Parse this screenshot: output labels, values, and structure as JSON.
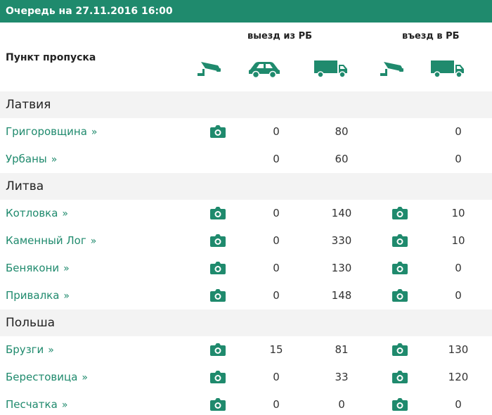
{
  "topbar": {
    "title": "Очередь на 27.11.2016 16:00"
  },
  "header": {
    "checkpoint_label": "Пункт пропуска",
    "exit_title": "выезд из РБ",
    "entry_title": "въезд в РБ"
  },
  "sections": [
    {
      "name": "Латвия",
      "rows": [
        {
          "name": "Григоровщина",
          "cam_out": true,
          "out_car": "0",
          "out_truck": "80",
          "cam_in": false,
          "in_truck": "0"
        },
        {
          "name": "Урбаны",
          "cam_out": false,
          "out_car": "0",
          "out_truck": "60",
          "cam_in": false,
          "in_truck": "0"
        }
      ]
    },
    {
      "name": "Литва",
      "rows": [
        {
          "name": "Котловка",
          "cam_out": true,
          "out_car": "0",
          "out_truck": "140",
          "cam_in": true,
          "in_truck": "10"
        },
        {
          "name": "Каменный Лог",
          "cam_out": true,
          "out_car": "0",
          "out_truck": "330",
          "cam_in": true,
          "in_truck": "10"
        },
        {
          "name": "Бенякони",
          "cam_out": true,
          "out_car": "0",
          "out_truck": "130",
          "cam_in": true,
          "in_truck": "0"
        },
        {
          "name": "Привалка",
          "cam_out": true,
          "out_car": "0",
          "out_truck": "148",
          "cam_in": true,
          "in_truck": "0"
        }
      ]
    },
    {
      "name": "Польша",
      "rows": [
        {
          "name": "Брузги",
          "cam_out": true,
          "out_car": "15",
          "out_truck": "81",
          "cam_in": true,
          "in_truck": "130"
        },
        {
          "name": "Берестовица",
          "cam_out": true,
          "out_car": "0",
          "out_truck": "33",
          "cam_in": true,
          "in_truck": "120"
        },
        {
          "name": "Песчатка",
          "cam_out": true,
          "out_car": "0",
          "out_truck": "0",
          "cam_in": true,
          "in_truck": "0"
        }
      ]
    }
  ],
  "icons": {
    "camera_header": "surveillance-camera-icon",
    "car": "car-icon",
    "truck": "truck-icon",
    "photo": "photo-camera-icon",
    "chevron": "»"
  },
  "colors": {
    "accent": "#1f8a6d",
    "section_bg": "#f3f3f3"
  }
}
